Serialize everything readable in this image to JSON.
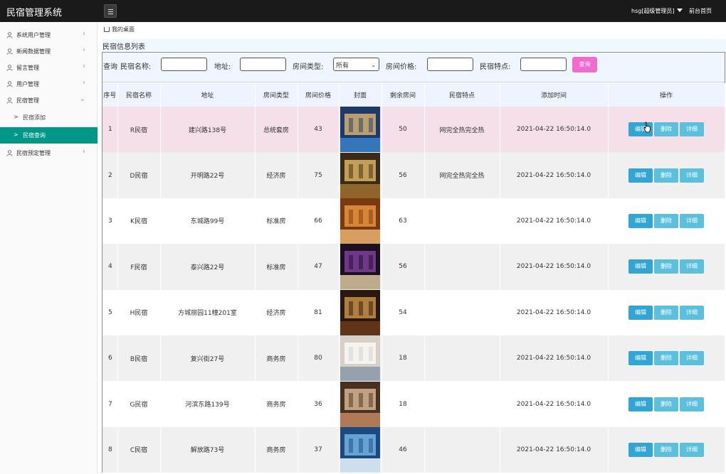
{
  "app": {
    "title": "民宿管理系统"
  },
  "header": {
    "user_label": "hsg[超级管理员]",
    "frontpage_label": "前台首页"
  },
  "sidebar": {
    "items": [
      {
        "label": "系统用户管理",
        "arrow": "‹"
      },
      {
        "label": "新闻数据管理",
        "arrow": "‹"
      },
      {
        "label": "留言管理",
        "arrow": "‹"
      },
      {
        "label": "用户管理",
        "arrow": "‹"
      },
      {
        "label": "民宿管理",
        "arrow": "⌄"
      },
      {
        "label": "民宿预定管理",
        "arrow": "‹"
      }
    ],
    "sub_items": [
      {
        "label": "民宿添加",
        "chev": ">"
      },
      {
        "label": "民宿查询",
        "chev": ">"
      }
    ]
  },
  "breadcrumb": {
    "label": "我的桌面"
  },
  "page_title": "民宿信息列表",
  "search": {
    "label_query": "查询",
    "label_name": "民宿名称:",
    "label_address": "地址:",
    "label_room_type": "房间类型:",
    "room_type_value": "所有",
    "label_price": "房间价格:",
    "label_features": "民宿特点:",
    "button": "查询"
  },
  "table": {
    "headers": [
      "序号",
      "民宿名称",
      "地址",
      "房间类型",
      "房间价格",
      "封面",
      "剩余房间",
      "民宿特点",
      "添加时间",
      "操作"
    ],
    "rows": [
      {
        "no": "1",
        "name": "R民宿",
        "address": "建兴路138号",
        "room_type": "总统套房",
        "price": "43",
        "remaining": "50",
        "features": "网完全热完全热",
        "added": "2021-04-22 16:50:14.0"
      },
      {
        "no": "2",
        "name": "D民宿",
        "address": "开明路22号",
        "room_type": "经济房",
        "price": "75",
        "remaining": "56",
        "features": "网完全热完全热",
        "added": "2021-04-22 16:50:14.0"
      },
      {
        "no": "3",
        "name": "K民宿",
        "address": "东城路99号",
        "room_type": "标准房",
        "price": "66",
        "remaining": "63",
        "features": "",
        "added": "2021-04-22 16:50:14.0"
      },
      {
        "no": "4",
        "name": "F民宿",
        "address": "泰兴路22号",
        "room_type": "标准房",
        "price": "47",
        "remaining": "56",
        "features": "",
        "added": "2021-04-22 16:50:14.0"
      },
      {
        "no": "5",
        "name": "H民宿",
        "address": "方城丽园11幢201室",
        "room_type": "经济房",
        "price": "81",
        "remaining": "54",
        "features": "",
        "added": "2021-04-22 16:50:14.0"
      },
      {
        "no": "6",
        "name": "B民宿",
        "address": "复兴街27号",
        "room_type": "商务房",
        "price": "80",
        "remaining": "18",
        "features": "",
        "added": "2021-04-22 16:50:14.0"
      },
      {
        "no": "7",
        "name": "G民宿",
        "address": "河滨东路139号",
        "room_type": "商务房",
        "price": "36",
        "remaining": "18",
        "features": "",
        "added": "2021-04-22 16:50:14.0"
      },
      {
        "no": "8",
        "name": "C民宿",
        "address": "解放路73号",
        "room_type": "商务房",
        "price": "37",
        "remaining": "46",
        "features": "",
        "added": "2021-04-22 16:50:14.0"
      }
    ],
    "actions": {
      "edit": "编辑",
      "delete": "删除",
      "detail": "详细"
    }
  },
  "colors": {
    "topbar": "#1a1a1a",
    "active_nav": "#009688",
    "search_button": "#f06ad0",
    "action_button": "#5bc0de",
    "hover_row": "#f5dfe8"
  }
}
